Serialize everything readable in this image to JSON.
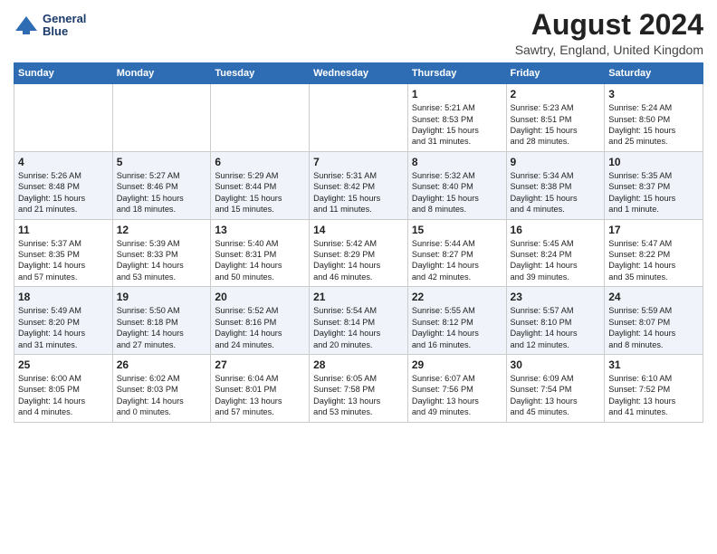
{
  "header": {
    "logo_line1": "General",
    "logo_line2": "Blue",
    "month_title": "August 2024",
    "location": "Sawtry, England, United Kingdom"
  },
  "weekdays": [
    "Sunday",
    "Monday",
    "Tuesday",
    "Wednesday",
    "Thursday",
    "Friday",
    "Saturday"
  ],
  "weeks": [
    [
      {
        "day": "",
        "info": ""
      },
      {
        "day": "",
        "info": ""
      },
      {
        "day": "",
        "info": ""
      },
      {
        "day": "",
        "info": ""
      },
      {
        "day": "1",
        "info": "Sunrise: 5:21 AM\nSunset: 8:53 PM\nDaylight: 15 hours\nand 31 minutes."
      },
      {
        "day": "2",
        "info": "Sunrise: 5:23 AM\nSunset: 8:51 PM\nDaylight: 15 hours\nand 28 minutes."
      },
      {
        "day": "3",
        "info": "Sunrise: 5:24 AM\nSunset: 8:50 PM\nDaylight: 15 hours\nand 25 minutes."
      }
    ],
    [
      {
        "day": "4",
        "info": "Sunrise: 5:26 AM\nSunset: 8:48 PM\nDaylight: 15 hours\nand 21 minutes."
      },
      {
        "day": "5",
        "info": "Sunrise: 5:27 AM\nSunset: 8:46 PM\nDaylight: 15 hours\nand 18 minutes."
      },
      {
        "day": "6",
        "info": "Sunrise: 5:29 AM\nSunset: 8:44 PM\nDaylight: 15 hours\nand 15 minutes."
      },
      {
        "day": "7",
        "info": "Sunrise: 5:31 AM\nSunset: 8:42 PM\nDaylight: 15 hours\nand 11 minutes."
      },
      {
        "day": "8",
        "info": "Sunrise: 5:32 AM\nSunset: 8:40 PM\nDaylight: 15 hours\nand 8 minutes."
      },
      {
        "day": "9",
        "info": "Sunrise: 5:34 AM\nSunset: 8:38 PM\nDaylight: 15 hours\nand 4 minutes."
      },
      {
        "day": "10",
        "info": "Sunrise: 5:35 AM\nSunset: 8:37 PM\nDaylight: 15 hours\nand 1 minute."
      }
    ],
    [
      {
        "day": "11",
        "info": "Sunrise: 5:37 AM\nSunset: 8:35 PM\nDaylight: 14 hours\nand 57 minutes."
      },
      {
        "day": "12",
        "info": "Sunrise: 5:39 AM\nSunset: 8:33 PM\nDaylight: 14 hours\nand 53 minutes."
      },
      {
        "day": "13",
        "info": "Sunrise: 5:40 AM\nSunset: 8:31 PM\nDaylight: 14 hours\nand 50 minutes."
      },
      {
        "day": "14",
        "info": "Sunrise: 5:42 AM\nSunset: 8:29 PM\nDaylight: 14 hours\nand 46 minutes."
      },
      {
        "day": "15",
        "info": "Sunrise: 5:44 AM\nSunset: 8:27 PM\nDaylight: 14 hours\nand 42 minutes."
      },
      {
        "day": "16",
        "info": "Sunrise: 5:45 AM\nSunset: 8:24 PM\nDaylight: 14 hours\nand 39 minutes."
      },
      {
        "day": "17",
        "info": "Sunrise: 5:47 AM\nSunset: 8:22 PM\nDaylight: 14 hours\nand 35 minutes."
      }
    ],
    [
      {
        "day": "18",
        "info": "Sunrise: 5:49 AM\nSunset: 8:20 PM\nDaylight: 14 hours\nand 31 minutes."
      },
      {
        "day": "19",
        "info": "Sunrise: 5:50 AM\nSunset: 8:18 PM\nDaylight: 14 hours\nand 27 minutes."
      },
      {
        "day": "20",
        "info": "Sunrise: 5:52 AM\nSunset: 8:16 PM\nDaylight: 14 hours\nand 24 minutes."
      },
      {
        "day": "21",
        "info": "Sunrise: 5:54 AM\nSunset: 8:14 PM\nDaylight: 14 hours\nand 20 minutes."
      },
      {
        "day": "22",
        "info": "Sunrise: 5:55 AM\nSunset: 8:12 PM\nDaylight: 14 hours\nand 16 minutes."
      },
      {
        "day": "23",
        "info": "Sunrise: 5:57 AM\nSunset: 8:10 PM\nDaylight: 14 hours\nand 12 minutes."
      },
      {
        "day": "24",
        "info": "Sunrise: 5:59 AM\nSunset: 8:07 PM\nDaylight: 14 hours\nand 8 minutes."
      }
    ],
    [
      {
        "day": "25",
        "info": "Sunrise: 6:00 AM\nSunset: 8:05 PM\nDaylight: 14 hours\nand 4 minutes."
      },
      {
        "day": "26",
        "info": "Sunrise: 6:02 AM\nSunset: 8:03 PM\nDaylight: 14 hours\nand 0 minutes."
      },
      {
        "day": "27",
        "info": "Sunrise: 6:04 AM\nSunset: 8:01 PM\nDaylight: 13 hours\nand 57 minutes."
      },
      {
        "day": "28",
        "info": "Sunrise: 6:05 AM\nSunset: 7:58 PM\nDaylight: 13 hours\nand 53 minutes."
      },
      {
        "day": "29",
        "info": "Sunrise: 6:07 AM\nSunset: 7:56 PM\nDaylight: 13 hours\nand 49 minutes."
      },
      {
        "day": "30",
        "info": "Sunrise: 6:09 AM\nSunset: 7:54 PM\nDaylight: 13 hours\nand 45 minutes."
      },
      {
        "day": "31",
        "info": "Sunrise: 6:10 AM\nSunset: 7:52 PM\nDaylight: 13 hours\nand 41 minutes."
      }
    ]
  ]
}
